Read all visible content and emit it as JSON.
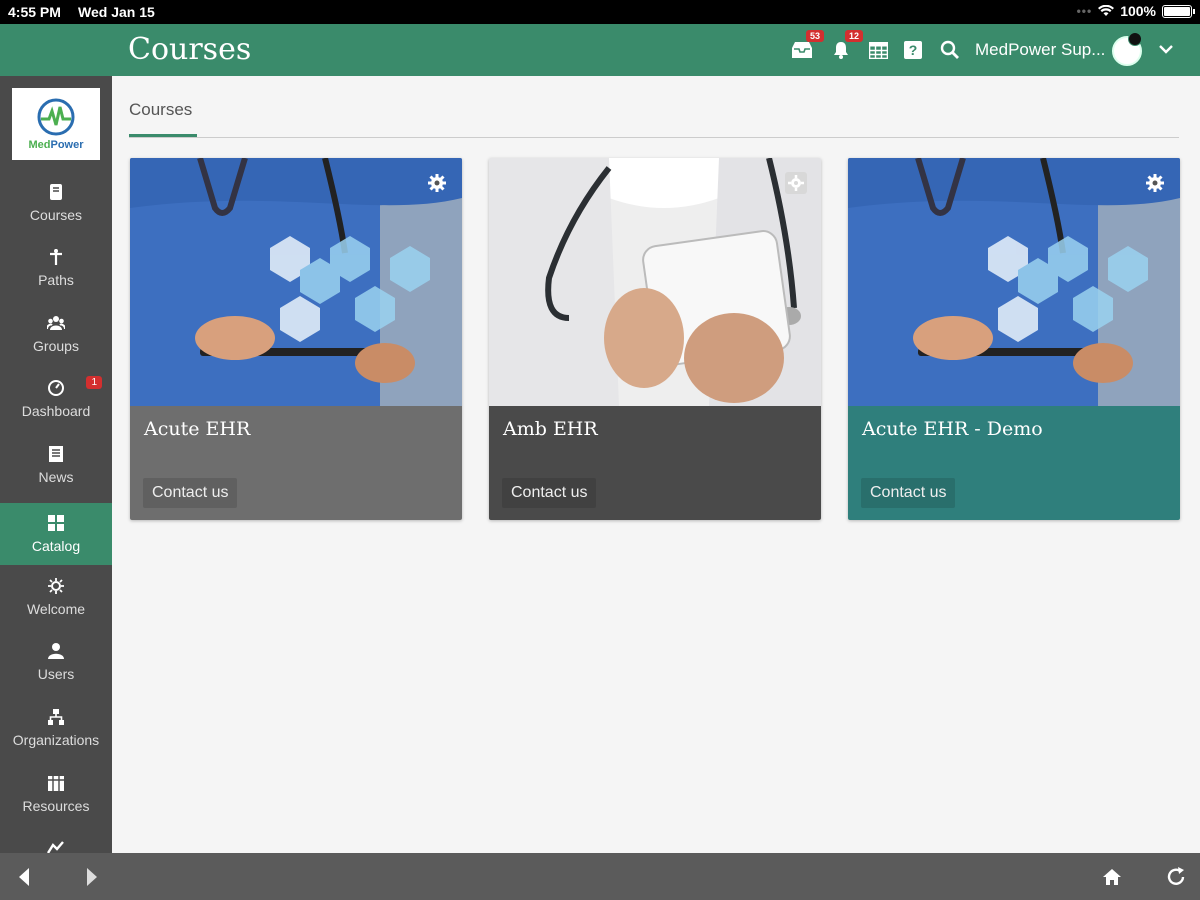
{
  "status_bar": {
    "time": "4:55 PM",
    "date": "Wed Jan 15",
    "battery": "100%"
  },
  "header": {
    "title": "Courses",
    "messages_badge": "53",
    "notifications_badge": "12",
    "username": "MedPower Sup...",
    "colors": {
      "bar": "#3a8b6b",
      "badge": "#d32f2f"
    }
  },
  "sidebar": {
    "logo_text_a": "Med",
    "logo_text_b": "Power",
    "items": [
      {
        "label": "Courses",
        "icon": "courses-icon"
      },
      {
        "label": "Paths",
        "icon": "paths-icon"
      },
      {
        "label": "Groups",
        "icon": "groups-icon"
      },
      {
        "label": "Dashboard",
        "icon": "dashboard-icon",
        "badge": "1"
      },
      {
        "label": "News",
        "icon": "news-icon"
      },
      {
        "label": "Catalog",
        "icon": "catalog-icon",
        "active": true
      },
      {
        "label": "Welcome",
        "icon": "welcome-icon"
      },
      {
        "label": "Users",
        "icon": "users-icon"
      },
      {
        "label": "Organizations",
        "icon": "organizations-icon"
      },
      {
        "label": "Resources",
        "icon": "resources-icon"
      }
    ]
  },
  "main": {
    "tab_label": "Courses",
    "cards": [
      {
        "title": "Acute EHR",
        "action": "Contact us",
        "color": "#6e6e6e"
      },
      {
        "title": "Amb EHR",
        "action": "Contact us",
        "color": "#4a4a4a"
      },
      {
        "title": "Acute EHR - Demo",
        "action": "Contact us",
        "color": "#2f7f7c"
      }
    ]
  },
  "bottom_bar": {
    "icons": [
      "back-icon",
      "forward-icon",
      "home-icon",
      "reload-icon"
    ]
  }
}
